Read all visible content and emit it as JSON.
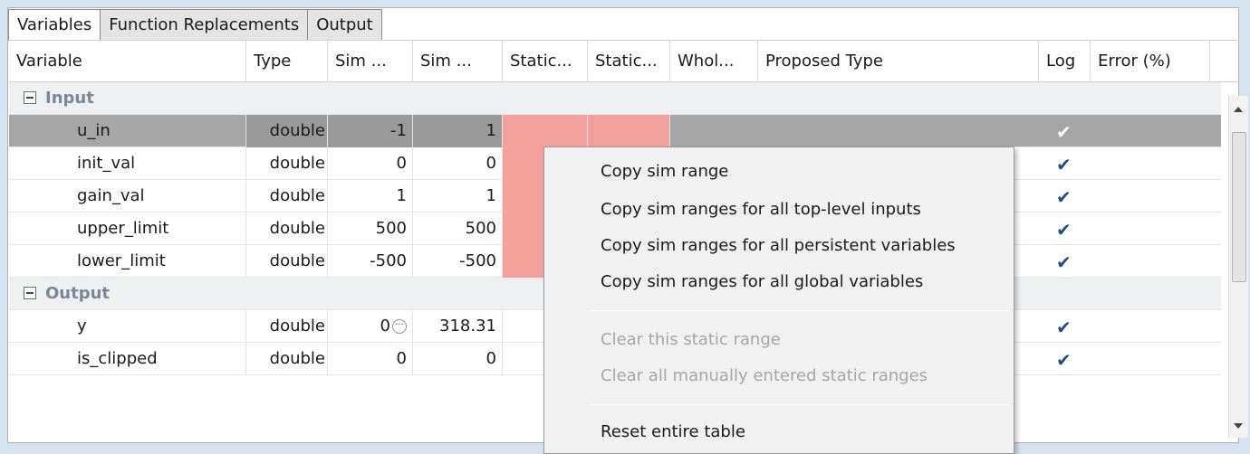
{
  "tabs": [
    {
      "label": "Variables",
      "active": true
    },
    {
      "label": "Function Replacements",
      "active": false
    },
    {
      "label": "Output",
      "active": false
    }
  ],
  "columns": [
    "Variable",
    "Type",
    "Sim ...",
    "Sim ...",
    "Static...",
    "Static...",
    "Whol...",
    "Proposed Type",
    "Log",
    "Error (%)"
  ],
  "groups": {
    "input": "Input",
    "output": "Output"
  },
  "rows": [
    {
      "name": "u_in",
      "type": "double",
      "sim_min": "-1",
      "sim_max": "1"
    },
    {
      "name": "init_val",
      "type": "double",
      "sim_min": "0",
      "sim_max": "0"
    },
    {
      "name": "gain_val",
      "type": "double",
      "sim_min": "1",
      "sim_max": "1"
    },
    {
      "name": "upper_limit",
      "type": "double",
      "sim_min": "500",
      "sim_max": "500"
    },
    {
      "name": "lower_limit",
      "type": "double",
      "sim_min": "-500",
      "sim_max": "-500"
    },
    {
      "name": "y",
      "type": "double",
      "sim_min": "0",
      "sim_max": "318.31"
    },
    {
      "name": "is_clipped",
      "type": "double",
      "sim_min": "0",
      "sim_max": "0"
    }
  ],
  "log_check_glyph": "✔",
  "dots_glyph": "···",
  "context_menu": {
    "items": [
      "Copy sim range",
      "Copy sim ranges for all top-level inputs",
      "Copy sim ranges for all persistent variables",
      "Copy sim ranges for all global variables"
    ],
    "disabled_items": [
      "Clear this static range",
      "Clear all manually entered static ranges"
    ],
    "reset": "Reset entire table"
  },
  "colors": {
    "static_range_highlight": "#f4a09c",
    "selected_row": "#a6a6a6",
    "check": "#1c4f8a"
  }
}
